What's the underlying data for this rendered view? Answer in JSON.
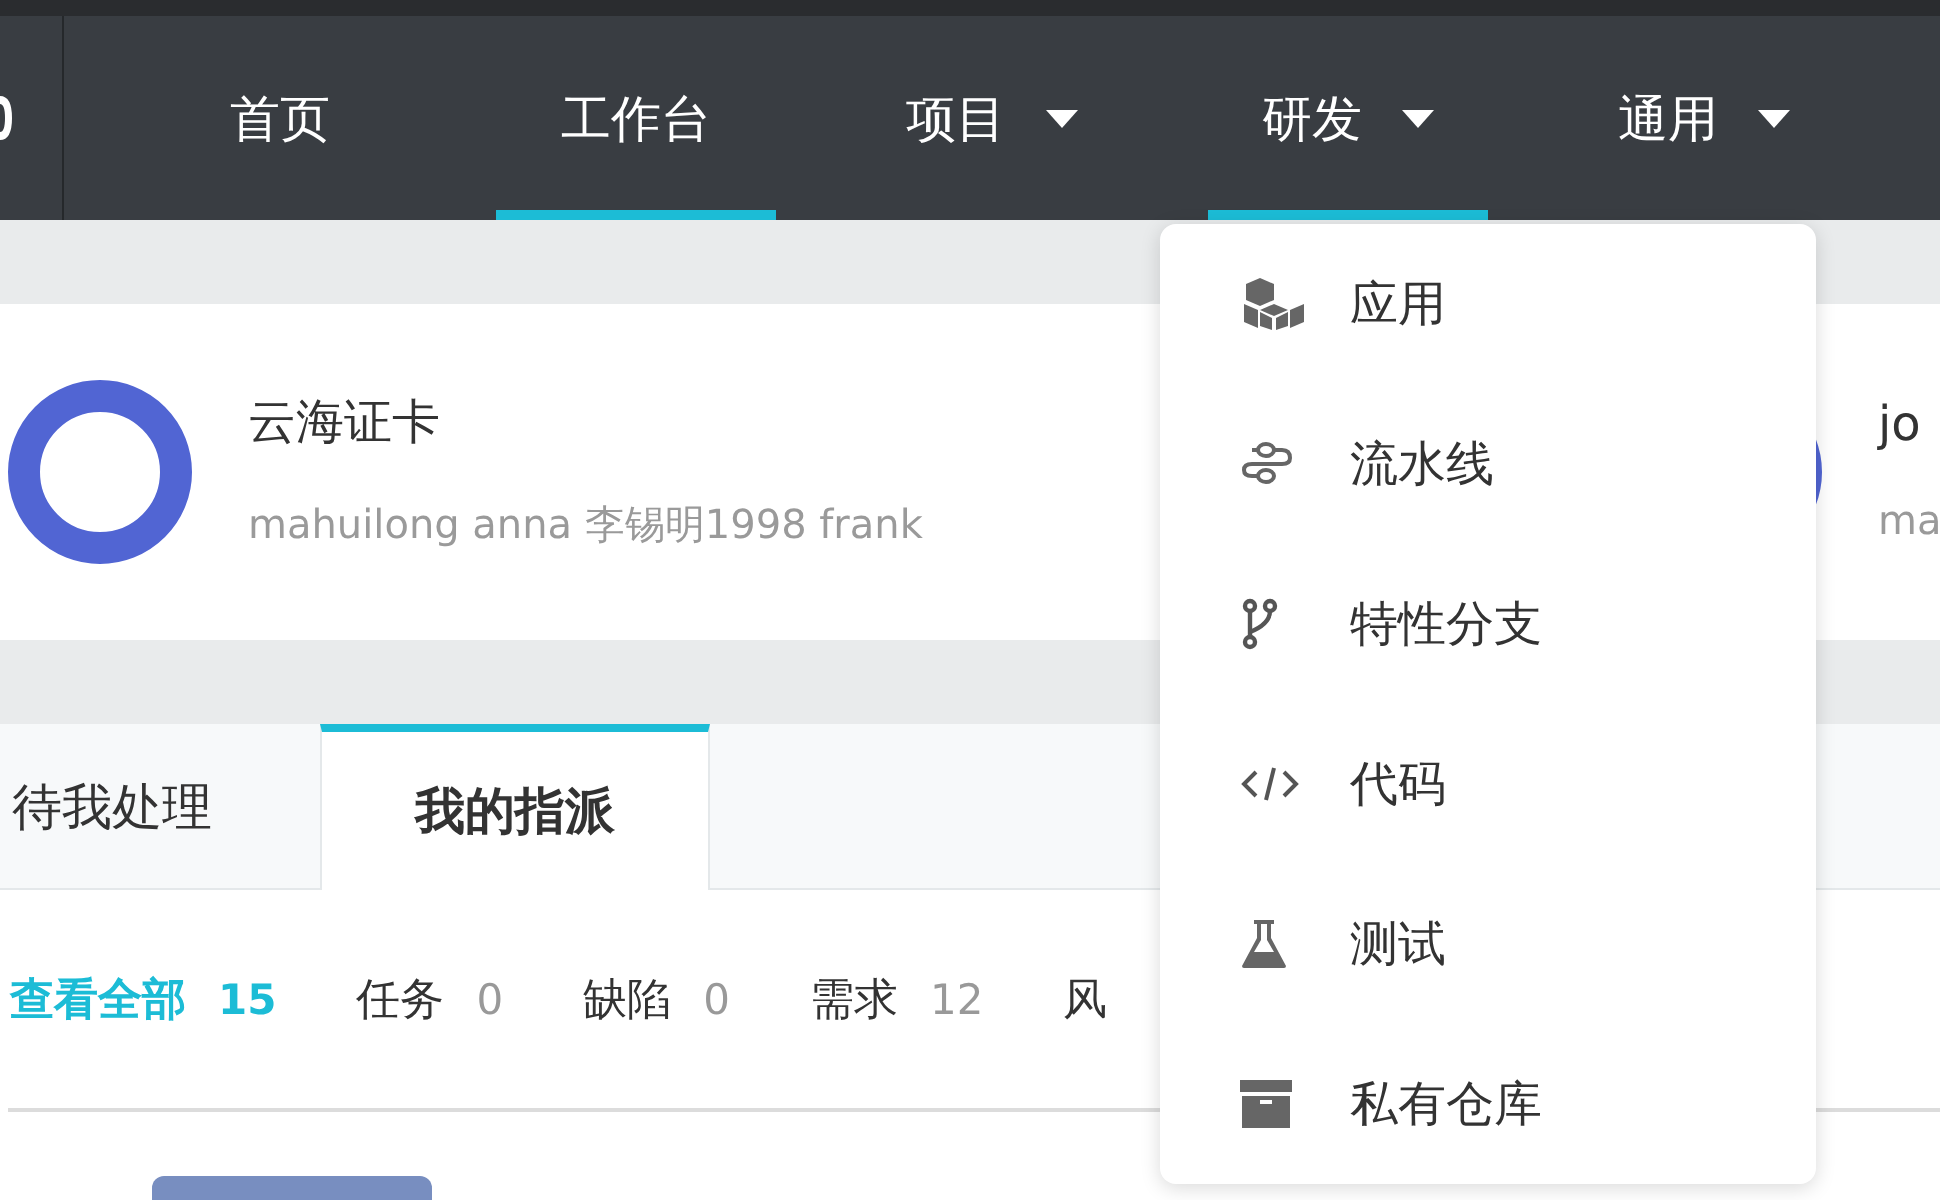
{
  "nav": {
    "items": [
      {
        "label": "首页",
        "dropdown": false,
        "selected": false
      },
      {
        "label": "工作台",
        "dropdown": false,
        "selected": true
      },
      {
        "label": "项目",
        "dropdown": true,
        "selected": false
      },
      {
        "label": "研发",
        "dropdown": true,
        "selected": true
      },
      {
        "label": "通用",
        "dropdown": true,
        "selected": false
      }
    ]
  },
  "projects": [
    {
      "title": "云海证卡",
      "members": "mahuilong anna 李锡明1998 frank"
    },
    {
      "title": "jo",
      "members": "ma"
    }
  ],
  "tabs": [
    {
      "label": "待我处理",
      "selected": false
    },
    {
      "label": "我的指派",
      "selected": true
    }
  ],
  "filters": [
    {
      "label": "查看全部",
      "count": "15",
      "selected": true
    },
    {
      "label": "任务",
      "count": "0",
      "selected": false
    },
    {
      "label": "缺陷",
      "count": "0",
      "selected": false
    },
    {
      "label": "需求",
      "count": "12",
      "selected": false
    },
    {
      "label": "风",
      "selected": false
    }
  ],
  "dropdown_menu": [
    {
      "label": "应用"
    },
    {
      "label": "流水线"
    },
    {
      "label": "特性分支"
    },
    {
      "label": "代码"
    },
    {
      "label": "测试"
    },
    {
      "label": "私有仓库"
    }
  ]
}
